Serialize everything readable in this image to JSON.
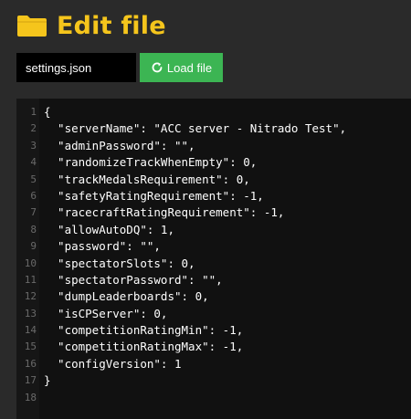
{
  "header": {
    "title": "Edit file",
    "icon": "folder-icon",
    "accent_color": "#f5c51c"
  },
  "toolbar": {
    "file_input_value": "settings.json",
    "load_button_label": "Load file",
    "load_button_icon": "reload-icon",
    "load_button_color": "#3cb553"
  },
  "editor": {
    "lines": [
      {
        "num": "1",
        "text": "{"
      },
      {
        "num": "2",
        "text": "  \"serverName\": \"ACC server - Nitrado Test\","
      },
      {
        "num": "3",
        "text": "  \"adminPassword\": \"\","
      },
      {
        "num": "4",
        "text": "  \"randomizeTrackWhenEmpty\": 0,"
      },
      {
        "num": "5",
        "text": "  \"trackMedalsRequirement\": 0,"
      },
      {
        "num": "6",
        "text": "  \"safetyRatingRequirement\": -1,"
      },
      {
        "num": "7",
        "text": "  \"racecraftRatingRequirement\": -1,"
      },
      {
        "num": "8",
        "text": "  \"allowAutoDQ\": 1,"
      },
      {
        "num": "9",
        "text": "  \"password\": \"\","
      },
      {
        "num": "10",
        "text": "  \"spectatorSlots\": 0,"
      },
      {
        "num": "11",
        "text": "  \"spectatorPassword\": \"\","
      },
      {
        "num": "12",
        "text": "  \"dumpLeaderboards\": 0,"
      },
      {
        "num": "13",
        "text": "  \"isCPServer\": 0,"
      },
      {
        "num": "14",
        "text": "  \"competitionRatingMin\": -1,"
      },
      {
        "num": "15",
        "text": "  \"competitionRatingMax\": -1,"
      },
      {
        "num": "16",
        "text": "  \"configVersion\": 1"
      },
      {
        "num": "17",
        "text": "}"
      },
      {
        "num": "18",
        "text": ""
      }
    ]
  }
}
